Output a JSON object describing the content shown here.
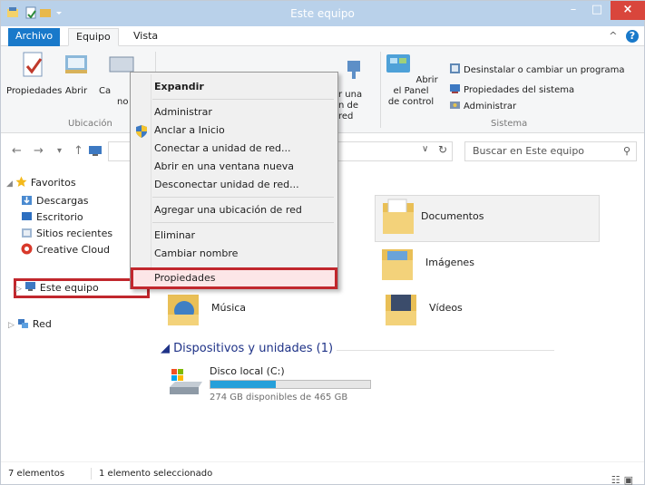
{
  "window": {
    "title": "Este equipo",
    "min_symbol": "–",
    "max_symbol": "□",
    "close_symbol": "×"
  },
  "ribbon": {
    "tabs": [
      "Archivo",
      "Equipo",
      "Vista"
    ],
    "collapse_symbol": "^",
    "help_symbol": "?",
    "ubicacion": {
      "propiedades": "Propiedades",
      "abrir": "Abrir",
      "cambiar_partial": "Ca",
      "cambiar_partial2": "no",
      "group_label": "Ubicación"
    },
    "red": {
      "label_partial1": "r una",
      "label_partial2": "n de red"
    },
    "panel": {
      "line1": "Abrir el Panel",
      "line2": "de control"
    },
    "sistema": {
      "items": [
        "Desinstalar o cambiar un programa",
        "Propiedades del sistema",
        "Administrar"
      ],
      "group_label": "Sistema"
    }
  },
  "address": {
    "back": "←",
    "forward": "→",
    "dropdown": "▾",
    "up": "↑",
    "chevron": "∨",
    "refresh": "↻",
    "search_placeholder": "Buscar en Este equipo",
    "search_symbol": "⚲"
  },
  "navpane": {
    "favoritos": "Favoritos",
    "items": [
      "Descargas",
      "Escritorio",
      "Sitios recientes",
      "Creative Cloud"
    ],
    "este_equipo": "Este equipo",
    "red": "Red"
  },
  "content": {
    "folders": [
      "Documentos",
      "Imágenes",
      "Música",
      "Vídeos"
    ],
    "section_title": "Dispositivos y unidades (1)",
    "drive": {
      "name": "Disco local (C:)",
      "free_text": "274 GB disponibles de 465 GB",
      "used_fraction": 0.41
    }
  },
  "context_menu": {
    "items": [
      "Expandir",
      "Administrar",
      "Anclar a Inicio",
      "Conectar a unidad de red...",
      "Abrir en una ventana nueva",
      "Desconectar unidad de red...",
      "Agregar una ubicación de red",
      "Eliminar",
      "Cambiar nombre",
      "Propiedades"
    ]
  },
  "status": {
    "count": "7 elementos",
    "selected": "1 elemento seleccionado"
  },
  "colors": {
    "accent": "#1979ca",
    "highlight_border": "#c1272d",
    "drive_fill": "#26a0da",
    "titlebar": "#b9d1ea"
  }
}
